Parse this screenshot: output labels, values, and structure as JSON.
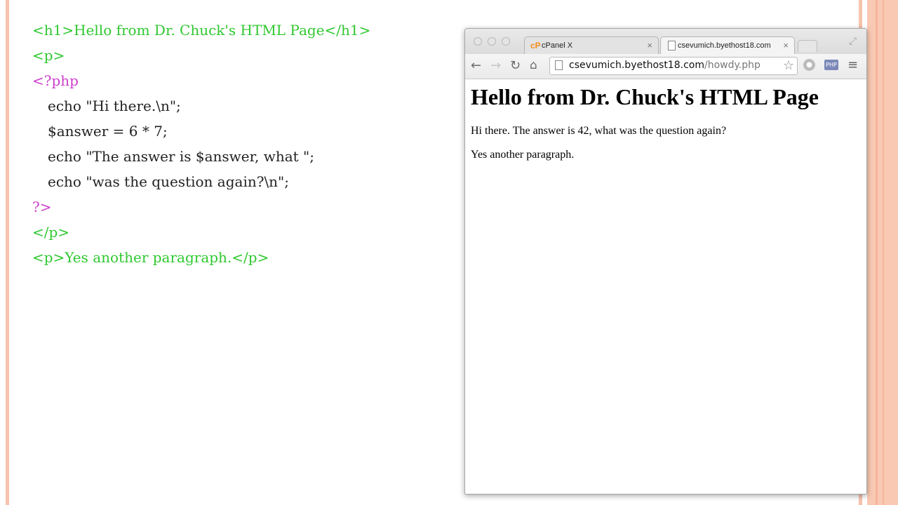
{
  "code_listing": {
    "lines": [
      {
        "text": "<h1>Hello from Dr. Chuck's HTML Page</h1>",
        "color": "#2fc82f"
      },
      {
        "text": "<p>",
        "color": "#2fc82f"
      },
      {
        "text": "<?php",
        "color": "#cc3fcc"
      },
      {
        "text": "echo \"Hi there.\\n\";",
        "color": "#222222"
      },
      {
        "text": "$answer = 6 * 7;",
        "color": "#222222"
      },
      {
        "text": "echo \"The answer is $answer, what \";",
        "color": "#222222"
      },
      {
        "text": "echo \"was the question again?\\n\";",
        "color": "#222222"
      },
      {
        "text": "?>",
        "color": "#cc3fcc"
      },
      {
        "text": "</p>",
        "color": "#2fc82f"
      },
      {
        "text": "<p>Yes another paragraph.</p>",
        "color": "#2fc82f"
      }
    ]
  },
  "browser": {
    "tabs": [
      {
        "title": "cPanel X",
        "favicon": "cpanel-logo",
        "favicon_text": "cP",
        "close": "×"
      },
      {
        "title": "csevumich.byethost18.com",
        "favicon": "document-icon",
        "close": "×"
      }
    ],
    "toolbar": {
      "back": "back-arrow-icon",
      "forward": "forward-arrow-icon",
      "reload": "reload-icon",
      "home": "home-icon",
      "star": "star-icon",
      "extension_php_label": "PHP",
      "menu": "hamburger-menu-icon"
    },
    "address": {
      "host": "csevumich.byethost18.com",
      "path": "/howdy.php"
    },
    "page": {
      "heading": "Hello from Dr. Chuck's HTML Page",
      "paragraph1": "Hi there. The answer is 42, what was the question again?",
      "paragraph2": "Yes another paragraph."
    }
  },
  "colors": {
    "html_tag": "#2fc82f",
    "php_tag": "#cc3fcc",
    "php_code": "#222222",
    "slide_border": "#f6c3ad",
    "cpanel_orange": "#f28c1e"
  }
}
